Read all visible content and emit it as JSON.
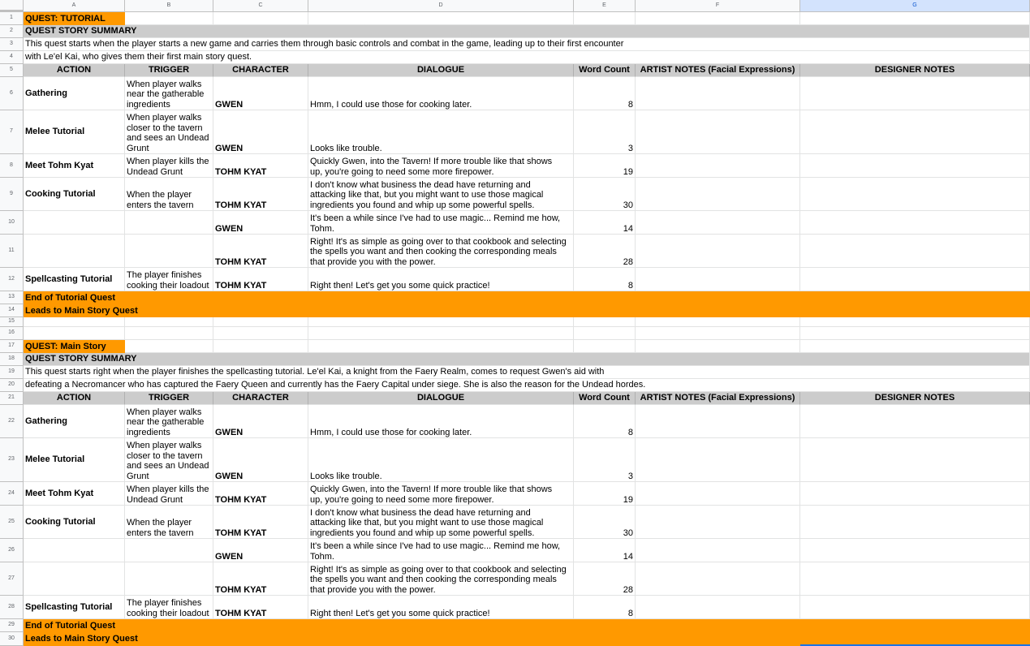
{
  "columns": [
    "A",
    "B",
    "C",
    "D",
    "E",
    "F",
    "G"
  ],
  "sections": [
    {
      "quest_title": "QUEST: TUTORIAL",
      "summary_heading": "QUEST STORY SUMMARY",
      "summary_lines": [
        "This quest starts when the player starts a new game and carries them through basic controls and combat in the game, leading up to their first encounter",
        "with Le'el Kai, who gives them their first main story quest."
      ],
      "headers": [
        "ACTION",
        "TRIGGER",
        "CHARACTER",
        "DIALOGUE",
        "Word Count",
        "ARTIST NOTES (Facial Expressions)",
        "DESIGNER NOTES"
      ],
      "rows": [
        {
          "action": "Gathering",
          "trigger": "When player walks near the gatherable ingredients",
          "character": "GWEN",
          "dialogue": "Hmm, I could use those for cooking later.",
          "count": "8"
        },
        {
          "action": "Melee Tutorial",
          "trigger": "When player walks closer to the tavern and sees an Undead Grunt",
          "character": "GWEN",
          "dialogue": "Looks like trouble.",
          "count": "3"
        },
        {
          "action": "Meet Tohm Kyat",
          "trigger": "When player kills the Undead Grunt",
          "character": "TOHM KYAT",
          "dialogue": "Quickly Gwen, into the Tavern! If more trouble like that shows up, you're going to need some more firepower.",
          "count": "19"
        },
        {
          "action": "Cooking Tutorial",
          "trigger": "When the player enters the tavern",
          "character": "TOHM KYAT",
          "dialogue": "I don't know what business the dead have returning and attacking like that, but you might want to use those magical ingredients you found and whip up some powerful spells.",
          "count": "30"
        },
        {
          "action": "",
          "trigger": "",
          "character": "GWEN",
          "dialogue": "It's been a while since I've had to use magic... Remind me how, Tohm.",
          "count": "14"
        },
        {
          "action": "",
          "trigger": "",
          "character": "TOHM KYAT",
          "dialogue": "Right! It's as simple as going over to that cookbook and selecting the spells you want and then cooking the corresponding meals that provide you with the power.",
          "count": "28"
        },
        {
          "action": "Spellcasting Tutorial",
          "trigger": "The player finishes cooking their loadout",
          "character": "TOHM KYAT",
          "dialogue": "Right then! Let's get you some quick practice!",
          "count": "8"
        }
      ],
      "end_line": "End of Tutorial Quest",
      "leads_line": "Leads to Main Story Quest"
    },
    {
      "quest_title": "QUEST: Main Story",
      "summary_heading": "QUEST STORY SUMMARY",
      "summary_lines": [
        "This quest starts right when the player finishes the spellcasting tutorial. Le'el Kai, a knight from the Faery Realm, comes to request Gwen's aid with",
        "defeating a Necromancer who has captured the Faery Queen and currently has the Faery Capital under siege. She is also the reason for the Undead hordes."
      ],
      "headers": [
        "ACTION",
        "TRIGGER",
        "CHARACTER",
        "DIALOGUE",
        "Word Count",
        "ARTIST NOTES (Facial Expressions)",
        "DESIGNER NOTES"
      ],
      "rows": [
        {
          "action": "Gathering",
          "trigger": "When player walks near the gatherable ingredients",
          "character": "GWEN",
          "dialogue": "Hmm, I could use those for cooking later.",
          "count": "8"
        },
        {
          "action": "Melee Tutorial",
          "trigger": "When player walks closer to the tavern and sees an Undead Grunt",
          "character": "GWEN",
          "dialogue": "Looks like trouble.",
          "count": "3"
        },
        {
          "action": "Meet Tohm Kyat",
          "trigger": "When player kills the Undead Grunt",
          "character": "TOHM KYAT",
          "dialogue": "Quickly Gwen, into the Tavern! If more trouble like that shows up, you're going to need some more firepower.",
          "count": "19"
        },
        {
          "action": "Cooking Tutorial",
          "trigger": "When the player enters the tavern",
          "character": "TOHM KYAT",
          "dialogue": "I don't know what business the dead have returning and attacking like that, but you might want to use those magical ingredients you found and whip up some powerful spells.",
          "count": "30"
        },
        {
          "action": "",
          "trigger": "",
          "character": "GWEN",
          "dialogue": "It's been a while since I've had to use magic... Remind me how, Tohm.",
          "count": "14"
        },
        {
          "action": "",
          "trigger": "",
          "character": "TOHM KYAT",
          "dialogue": "Right! It's as simple as going over to that cookbook and selecting the spells you want and then cooking the corresponding meals that provide you with the power.",
          "count": "28"
        },
        {
          "action": "Spellcasting Tutorial",
          "trigger": "The player finishes cooking their loadout",
          "character": "TOHM KYAT",
          "dialogue": "Right then! Let's get you some quick practice!",
          "count": "8"
        }
      ],
      "end_line": "End of Tutorial Quest",
      "leads_line": "Leads to Main Story Quest"
    }
  ],
  "colors": {
    "accent_orange": "#ff9900",
    "header_grey": "#cccccc",
    "selected_col": "#d3e3fd"
  }
}
